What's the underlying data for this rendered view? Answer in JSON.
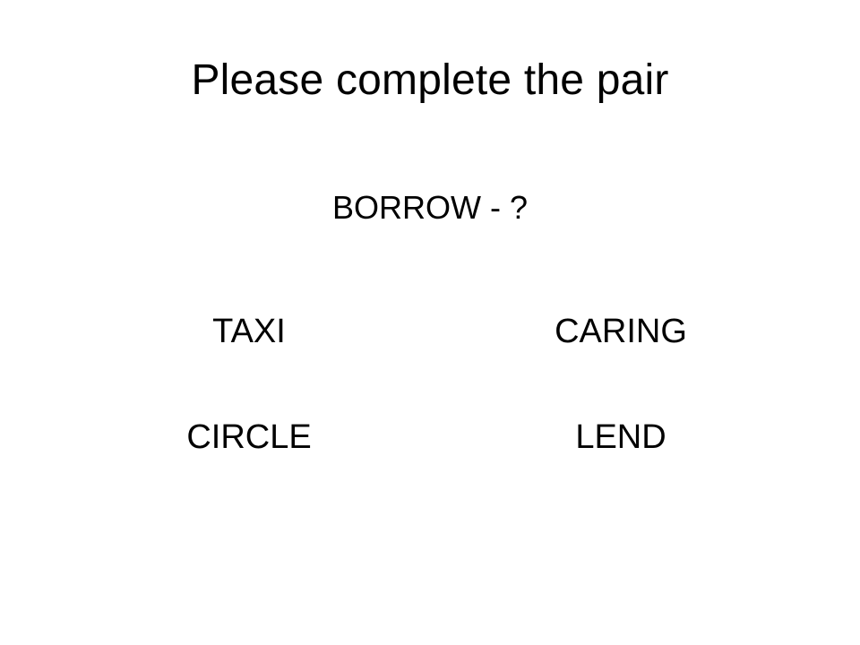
{
  "slide": {
    "title": "Please complete the pair",
    "prompt": "BORROW - ?",
    "options": [
      "TAXI",
      "CARING",
      "CIRCLE",
      "LEND"
    ]
  }
}
